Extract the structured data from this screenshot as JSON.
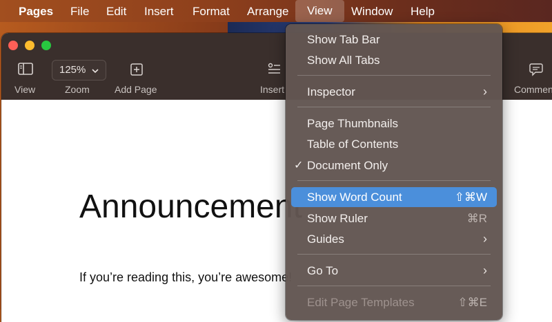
{
  "menubar": {
    "app": "Pages",
    "items": [
      "File",
      "Edit",
      "Insert",
      "Format",
      "Arrange",
      "View",
      "Window",
      "Help"
    ]
  },
  "toolbar": {
    "zoom_value": "125%",
    "labels": {
      "view": "View",
      "zoom": "Zoom",
      "add_page": "Add Page",
      "insert": "Insert",
      "comment": "Comment"
    }
  },
  "document": {
    "title": "Announcement",
    "body": "If you’re reading this, you’re awesome!"
  },
  "view_menu": {
    "items": [
      {
        "label": "Show Tab Bar"
      },
      {
        "label": "Show All Tabs"
      },
      {
        "label": "Inspector"
      },
      {
        "label": "Page Thumbnails"
      },
      {
        "label": "Table of Contents"
      },
      {
        "label": "Document Only",
        "checked": true
      },
      {
        "label": "Show Word Count",
        "shortcut": "⇧⌘W",
        "highlighted": true
      },
      {
        "label": "Show Ruler",
        "shortcut": "⌘R"
      },
      {
        "label": "Guides"
      },
      {
        "label": "Go To"
      },
      {
        "label": "Edit Page Templates",
        "shortcut": "⇧⌘E",
        "disabled": true
      }
    ],
    "checkmark": "✓",
    "submenu_arrow": "›"
  },
  "colors": {
    "highlight": "#4b8fdb",
    "close": "#ff5f57",
    "minimize": "#febc2e",
    "zoom": "#28c840"
  }
}
